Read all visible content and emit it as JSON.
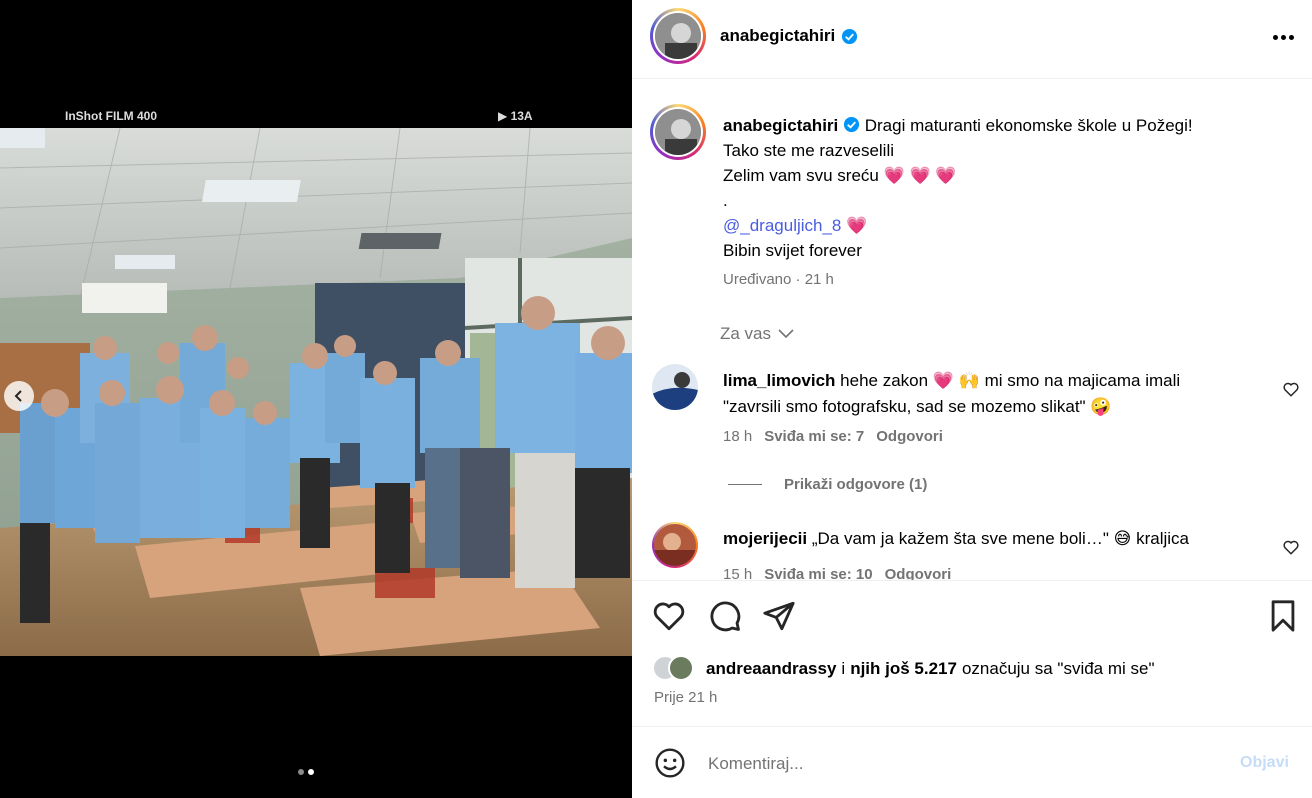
{
  "media": {
    "film_label": "InShot FILM 400",
    "film_counter": "13A",
    "carousel_dots": 2,
    "active_dot": 1
  },
  "header": {
    "username": "anabegictahiri",
    "more_icon": "more-horizontal-icon"
  },
  "caption": {
    "username": "anabegictahiri",
    "lines": [
      "Dragi maturanti ekonomske škole u Požegi!",
      "Tako ste me razveselili",
      "Zelim vam svu sreću",
      ".",
      "@_draguljich_8",
      "Bibin svijet forever"
    ],
    "hearts_line3": "💗 💗 💗",
    "heart_mention": "💗",
    "meta": "Uređivano · 21 h"
  },
  "sort_label": "Za vas",
  "comments": [
    {
      "username": "lima_limovich",
      "text_part1": "hehe zakon",
      "emoji1": "💗 🙌",
      "text_part2": "mi smo na majicama imali",
      "text_line2": "\"zavrsili smo fotografsku, sad se mozemo slikat\"",
      "emoji2": "🤪",
      "time": "18 h",
      "likes": "Sviđa mi se: 7",
      "reply": "Odgovori"
    },
    {
      "username": "mojerijecii",
      "text_part1": "„Da vam ja kažem šta sve mene boli…\"",
      "emoji1": "😅",
      "text_part2": "kraljica",
      "time": "15 h",
      "likes": "Sviđa mi se: 10",
      "reply": "Odgovori"
    }
  ],
  "view_replies": "Prikaži odgovore (1)",
  "likes": {
    "user": "andreaandrassy",
    "connector": "i",
    "others": "njih još 5.217",
    "suffix": "označuju sa \"sviđa mi se\""
  },
  "posted_time": "Prije 21 h",
  "comment_box": {
    "placeholder": "Komentiraj...",
    "post_label": "Objavi"
  },
  "colors": {
    "mention": "#4a5de0",
    "verified": "#0095f6",
    "post_disabled": "#c5dcf8",
    "muted": "#737373"
  }
}
